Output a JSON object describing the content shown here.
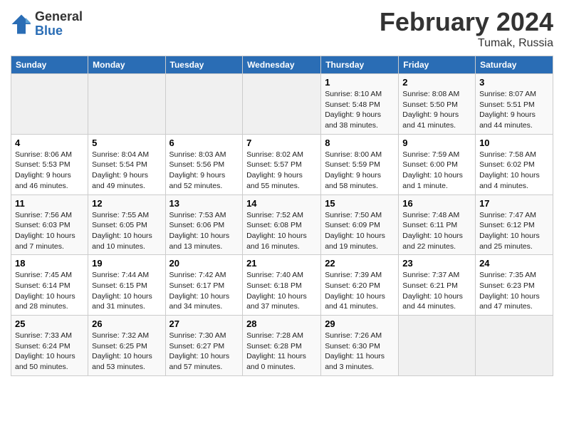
{
  "header": {
    "logo_general": "General",
    "logo_blue": "Blue",
    "title": "February 2024",
    "location": "Tumak, Russia"
  },
  "days_of_week": [
    "Sunday",
    "Monday",
    "Tuesday",
    "Wednesday",
    "Thursday",
    "Friday",
    "Saturday"
  ],
  "weeks": [
    [
      {
        "day": "",
        "empty": true
      },
      {
        "day": "",
        "empty": true
      },
      {
        "day": "",
        "empty": true
      },
      {
        "day": "",
        "empty": true
      },
      {
        "day": "1",
        "sunrise": "8:10 AM",
        "sunset": "5:48 PM",
        "daylight": "9 hours and 38 minutes."
      },
      {
        "day": "2",
        "sunrise": "8:08 AM",
        "sunset": "5:50 PM",
        "daylight": "9 hours and 41 minutes."
      },
      {
        "day": "3",
        "sunrise": "8:07 AM",
        "sunset": "5:51 PM",
        "daylight": "9 hours and 44 minutes."
      }
    ],
    [
      {
        "day": "4",
        "sunrise": "8:06 AM",
        "sunset": "5:53 PM",
        "daylight": "9 hours and 46 minutes."
      },
      {
        "day": "5",
        "sunrise": "8:04 AM",
        "sunset": "5:54 PM",
        "daylight": "9 hours and 49 minutes."
      },
      {
        "day": "6",
        "sunrise": "8:03 AM",
        "sunset": "5:56 PM",
        "daylight": "9 hours and 52 minutes."
      },
      {
        "day": "7",
        "sunrise": "8:02 AM",
        "sunset": "5:57 PM",
        "daylight": "9 hours and 55 minutes."
      },
      {
        "day": "8",
        "sunrise": "8:00 AM",
        "sunset": "5:59 PM",
        "daylight": "9 hours and 58 minutes."
      },
      {
        "day": "9",
        "sunrise": "7:59 AM",
        "sunset": "6:00 PM",
        "daylight": "10 hours and 1 minute."
      },
      {
        "day": "10",
        "sunrise": "7:58 AM",
        "sunset": "6:02 PM",
        "daylight": "10 hours and 4 minutes."
      }
    ],
    [
      {
        "day": "11",
        "sunrise": "7:56 AM",
        "sunset": "6:03 PM",
        "daylight": "10 hours and 7 minutes."
      },
      {
        "day": "12",
        "sunrise": "7:55 AM",
        "sunset": "6:05 PM",
        "daylight": "10 hours and 10 minutes."
      },
      {
        "day": "13",
        "sunrise": "7:53 AM",
        "sunset": "6:06 PM",
        "daylight": "10 hours and 13 minutes."
      },
      {
        "day": "14",
        "sunrise": "7:52 AM",
        "sunset": "6:08 PM",
        "daylight": "10 hours and 16 minutes."
      },
      {
        "day": "15",
        "sunrise": "7:50 AM",
        "sunset": "6:09 PM",
        "daylight": "10 hours and 19 minutes."
      },
      {
        "day": "16",
        "sunrise": "7:48 AM",
        "sunset": "6:11 PM",
        "daylight": "10 hours and 22 minutes."
      },
      {
        "day": "17",
        "sunrise": "7:47 AM",
        "sunset": "6:12 PM",
        "daylight": "10 hours and 25 minutes."
      }
    ],
    [
      {
        "day": "18",
        "sunrise": "7:45 AM",
        "sunset": "6:14 PM",
        "daylight": "10 hours and 28 minutes."
      },
      {
        "day": "19",
        "sunrise": "7:44 AM",
        "sunset": "6:15 PM",
        "daylight": "10 hours and 31 minutes."
      },
      {
        "day": "20",
        "sunrise": "7:42 AM",
        "sunset": "6:17 PM",
        "daylight": "10 hours and 34 minutes."
      },
      {
        "day": "21",
        "sunrise": "7:40 AM",
        "sunset": "6:18 PM",
        "daylight": "10 hours and 37 minutes."
      },
      {
        "day": "22",
        "sunrise": "7:39 AM",
        "sunset": "6:20 PM",
        "daylight": "10 hours and 41 minutes."
      },
      {
        "day": "23",
        "sunrise": "7:37 AM",
        "sunset": "6:21 PM",
        "daylight": "10 hours and 44 minutes."
      },
      {
        "day": "24",
        "sunrise": "7:35 AM",
        "sunset": "6:23 PM",
        "daylight": "10 hours and 47 minutes."
      }
    ],
    [
      {
        "day": "25",
        "sunrise": "7:33 AM",
        "sunset": "6:24 PM",
        "daylight": "10 hours and 50 minutes."
      },
      {
        "day": "26",
        "sunrise": "7:32 AM",
        "sunset": "6:25 PM",
        "daylight": "10 hours and 53 minutes."
      },
      {
        "day": "27",
        "sunrise": "7:30 AM",
        "sunset": "6:27 PM",
        "daylight": "10 hours and 57 minutes."
      },
      {
        "day": "28",
        "sunrise": "7:28 AM",
        "sunset": "6:28 PM",
        "daylight": "11 hours and 0 minutes."
      },
      {
        "day": "29",
        "sunrise": "7:26 AM",
        "sunset": "6:30 PM",
        "daylight": "11 hours and 3 minutes."
      },
      {
        "day": "",
        "empty": true
      },
      {
        "day": "",
        "empty": true
      }
    ]
  ],
  "labels": {
    "sunrise": "Sunrise:",
    "sunset": "Sunset:",
    "daylight": "Daylight:"
  }
}
